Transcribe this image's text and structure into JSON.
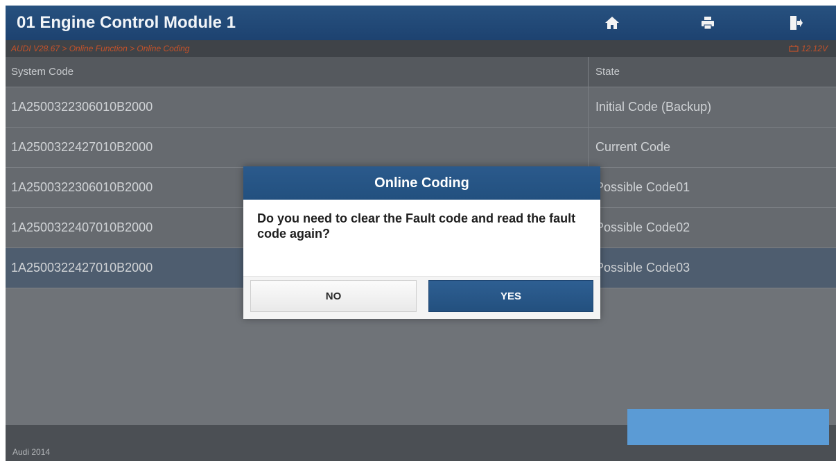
{
  "window": {
    "title": "01 Engine Control Module 1",
    "icons": [
      "home-icon",
      "print-icon",
      "exit-icon"
    ]
  },
  "breadcrumb": "AUDI V28.67 > Online Function > Online Coding",
  "voltage": "12.12V",
  "table": {
    "headers": {
      "code": "System Code",
      "state": "State"
    },
    "rows": [
      {
        "code": "1A2500322306010B2000",
        "state": "Initial Code (Backup)"
      },
      {
        "code": "1A2500322427010B2000",
        "state": "Current Code"
      },
      {
        "code": "1A2500322306010B2000",
        "state": "Possible Code01"
      },
      {
        "code": "1A2500322407010B2000",
        "state": "Possible Code02"
      },
      {
        "code": "1A2500322427010B2000",
        "state": "Possible Code03"
      }
    ]
  },
  "footer": {
    "vehicle": "Audi  2014"
  },
  "dialog": {
    "title": "Online Coding",
    "message": "Do you need to clear the Fault code and read the fault code again?",
    "no_label": "NO",
    "yes_label": "YES"
  },
  "colors": {
    "title_bar": "#1d4270",
    "accent_button": "#5b9bd5",
    "breadcrumb_text": "#c4522a"
  }
}
